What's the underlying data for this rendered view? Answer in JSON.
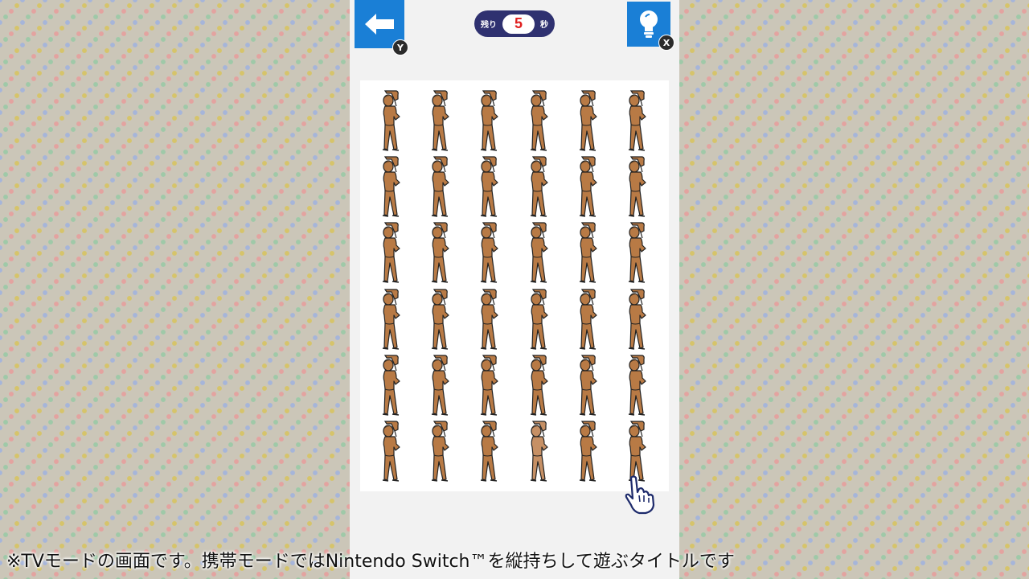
{
  "header": {
    "back_badge": "Y",
    "hint_badge": "X",
    "timer": {
      "prefix": "残り",
      "value": "5",
      "suffix": "秒"
    }
  },
  "board": {
    "rows": 6,
    "cols": 6,
    "odd_cell": {
      "row": 6,
      "col": 4
    },
    "figure_color": "#b87a45",
    "odd_figure_color": "#c69065"
  },
  "icons": [
    "back-arrow-icon",
    "lightbulb-icon",
    "pointer-hand-icon"
  ],
  "footer": {
    "caption": "※TVモードの画面です。携帯モードではNintendo Switch™を縦持ちして遊ぶタイトルです"
  }
}
